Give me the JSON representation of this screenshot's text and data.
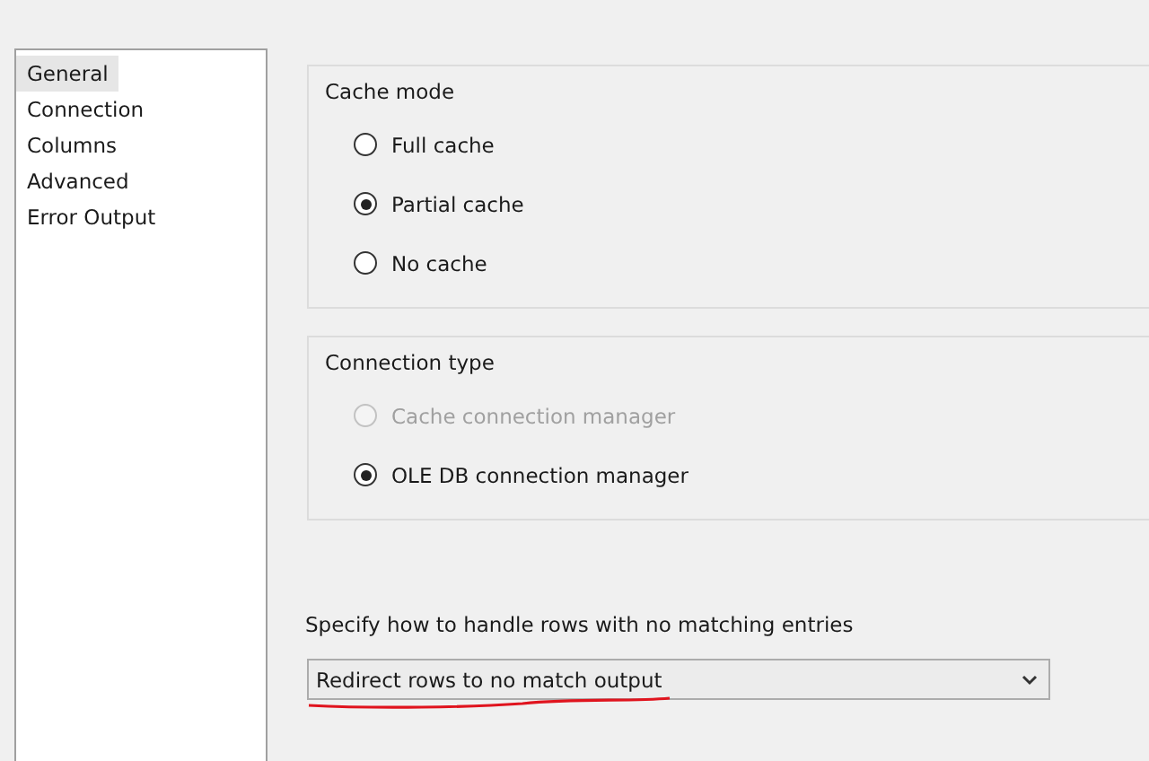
{
  "sidebar": {
    "items": [
      {
        "label": "General",
        "selected": true
      },
      {
        "label": "Connection",
        "selected": false
      },
      {
        "label": "Columns",
        "selected": false
      },
      {
        "label": "Advanced",
        "selected": false
      },
      {
        "label": "Error Output",
        "selected": false
      }
    ]
  },
  "groups": [
    {
      "title": "Cache mode",
      "options": [
        {
          "label": "Full cache",
          "selected": false,
          "disabled": false
        },
        {
          "label": "Partial cache",
          "selected": true,
          "disabled": false
        },
        {
          "label": "No cache",
          "selected": false,
          "disabled": false
        }
      ]
    },
    {
      "title": "Connection type",
      "options": [
        {
          "label": "Cache connection manager",
          "selected": false,
          "disabled": true
        },
        {
          "label": "OLE DB connection manager",
          "selected": true,
          "disabled": false
        }
      ]
    }
  ],
  "no_match": {
    "label": "Specify how to handle rows with no matching entries",
    "value": "Redirect rows to no match output",
    "underlined": true
  }
}
